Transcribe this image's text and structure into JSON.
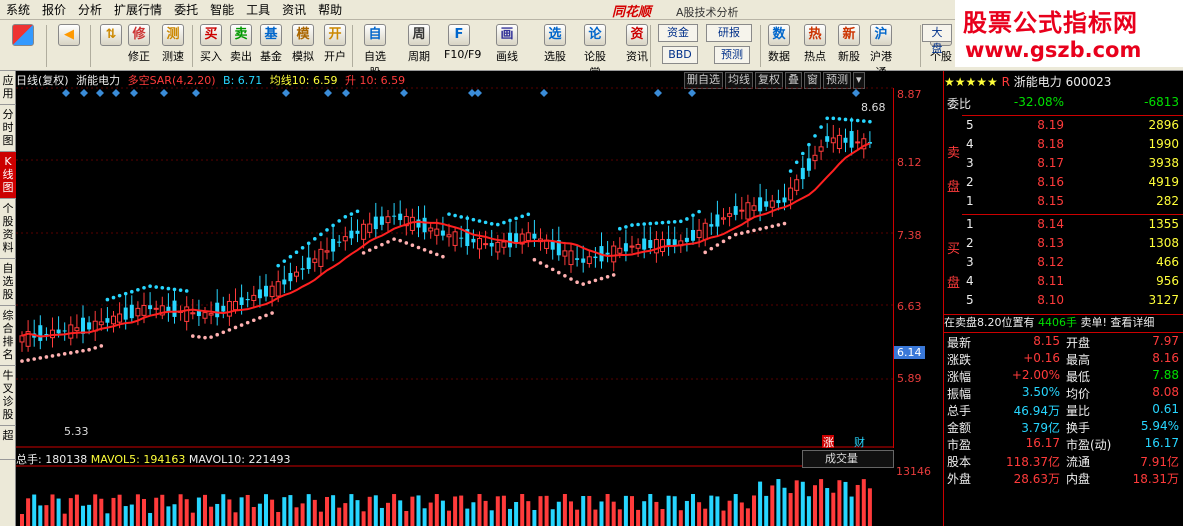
{
  "menu": [
    "系统",
    "报价",
    "分析",
    "扩展行情",
    "委托",
    "智能",
    "工具",
    "资讯",
    "帮助"
  ],
  "app": {
    "logo": "同花顺",
    "subtitle": "A股技术分析"
  },
  "watermark": {
    "line1": "股票公式指标网",
    "line2": "www.gszb.com"
  },
  "toolbar": {
    "buttons": [
      "修正",
      "测速",
      "买入",
      "卖出",
      "基金",
      "模拟",
      "开户",
      "自选股",
      "周期",
      "F10/F9",
      "画线",
      "选股",
      "论股堂",
      "资讯",
      "数据",
      "热点",
      "新股",
      "沪港通",
      "个股"
    ],
    "small": [
      "资金",
      "研报",
      "BBD",
      "预测",
      "大盘"
    ]
  },
  "left_tabs": [
    "应用",
    "分时图",
    "K线图",
    "个股资料",
    "自选股",
    "综合排名",
    "牛叉诊股",
    "超"
  ],
  "chart": {
    "header": {
      "mode": "日线(复权)",
      "name": "浙能电力",
      "ind": "多空SAR(4,2,20)",
      "b": "B: 6.71",
      "ma": "均线10: 6.59",
      "sh": "升 10: 6.59"
    },
    "ctrls": [
      "删自选",
      "均线",
      "复权",
      "叠",
      "窗",
      "预测"
    ],
    "axis": [
      "8.87",
      "8.12",
      "7.38",
      "6.63",
      "6.14",
      "5.89"
    ],
    "hi_label": "8.68",
    "lo_label": "5.33",
    "marker1": "涨",
    "marker2": "财"
  },
  "volume": {
    "label": "总手: 180138",
    "mavol5": "MAVOL5: 194163",
    "mavol10": "MAVOL10: 221493",
    "axis": "13146",
    "select": "成交量"
  },
  "quote": {
    "title": "浙能电力",
    "code": "600023",
    "r": "R",
    "weibi": {
      "label": "委比",
      "pct": "-32.08%",
      "val": "-6813"
    },
    "sell_label": "卖盘",
    "buy_label": "买盘",
    "asks": [
      [
        "5",
        "8.19",
        "2896"
      ],
      [
        "4",
        "8.18",
        "1990"
      ],
      [
        "3",
        "8.17",
        "3938"
      ],
      [
        "2",
        "8.16",
        "4919"
      ],
      [
        "1",
        "8.15",
        "282"
      ]
    ],
    "bids": [
      [
        "1",
        "8.14",
        "1355"
      ],
      [
        "2",
        "8.13",
        "1308"
      ],
      [
        "3",
        "8.12",
        "466"
      ],
      [
        "4",
        "8.11",
        "956"
      ],
      [
        "5",
        "8.10",
        "3127"
      ]
    ],
    "notice": {
      "text": "在卖盘8.20位置有",
      "vol": "4406手",
      "act": "卖单!",
      "more": "查看详细"
    },
    "stats": [
      [
        "最新",
        "8.15",
        "开盘",
        "7.97"
      ],
      [
        "涨跌",
        "+0.16",
        "最高",
        "8.16"
      ],
      [
        "涨幅",
        "+2.00%",
        "最低",
        "7.88"
      ],
      [
        "振幅",
        "3.50%",
        "均价",
        "8.08"
      ],
      [
        "总手",
        "46.94万",
        "量比",
        "0.61"
      ],
      [
        "金额",
        "3.79亿",
        "换手",
        "5.94%"
      ],
      [
        "市盈",
        "16.17",
        "市盈(动)",
        "16.17"
      ],
      [
        "股本",
        "118.37亿",
        "流通",
        "7.91亿"
      ],
      [
        "外盘",
        "28.63万",
        "内盘",
        "18.31万"
      ]
    ]
  },
  "chart_data": {
    "type": "candlestick",
    "title": "浙能电力",
    "y_ticks": [
      8.87,
      8.12,
      7.38,
      6.63,
      6.14,
      5.89
    ],
    "annotated_high": 8.68,
    "annotated_low": 5.33,
    "indicators": {
      "SAR": "4,2,20",
      "MA10": 6.59
    },
    "volume": {
      "last": 180138,
      "MAVOL5": 194163,
      "MAVOL10": 221493,
      "axis_max": 13146
    }
  }
}
